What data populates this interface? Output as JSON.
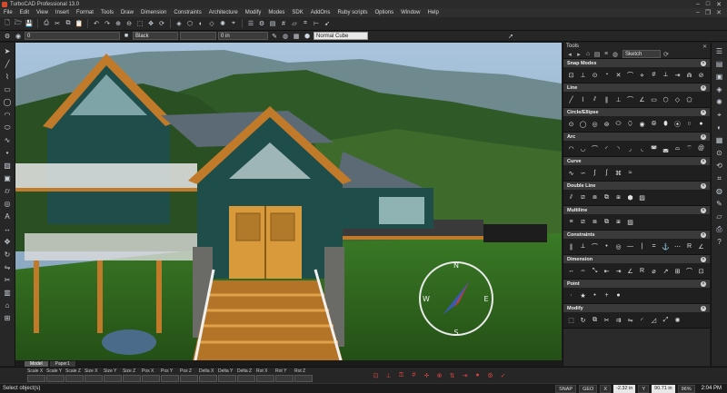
{
  "window": {
    "title": "TurboCAD Professional 13.0"
  },
  "menu": [
    "File",
    "Edit",
    "View",
    "Insert",
    "Format",
    "Tools",
    "Draw",
    "Dimension",
    "Constraints",
    "Architecture",
    "Modify",
    "Modes",
    "SDK",
    "AddOns",
    "Ruby scripts",
    "Options",
    "Window",
    "Help"
  ],
  "toolbar2": {
    "layer_value": "0",
    "color_value": "Black",
    "thickness_value": "0 in",
    "style_value": "Normal Cube"
  },
  "viewport_tabs": [
    "Model",
    "Paper1"
  ],
  "panel": {
    "title": "Tools",
    "palette_value": "Sketch",
    "sections": [
      "Snap Modes",
      "Line",
      "Circle/Ellipse",
      "Arc",
      "Curve",
      "Double Line",
      "Multiline",
      "Constraints",
      "Dimension",
      "Point",
      "Modify"
    ]
  },
  "coord_labels": [
    "Scale X",
    "Scale Y",
    "Scale Z",
    "Size X",
    "Size Y",
    "Size Z",
    "Pos X",
    "Pos Y",
    "Pos Z",
    "Delta X",
    "Delta Y",
    "Delta Z",
    "Rot X",
    "Rot Y",
    "Rot Z"
  ],
  "status": {
    "prompt": "Select object(s)",
    "snap": "SNAP",
    "geo": "GEO",
    "x_value": "-2.32 in",
    "y_value": "90.71 in",
    "zoom": "96%",
    "clock": "2:04 PM"
  },
  "scene": {
    "compass_letters": [
      "N",
      "S",
      "W",
      "E"
    ],
    "colors": {
      "house_wall": "#1f4d4a",
      "roof": "#5b6a74",
      "trim": "#c07a2a",
      "door": "#d89a3a",
      "lawn": "#2e6a1e",
      "sky": "#8fb4d4"
    }
  }
}
